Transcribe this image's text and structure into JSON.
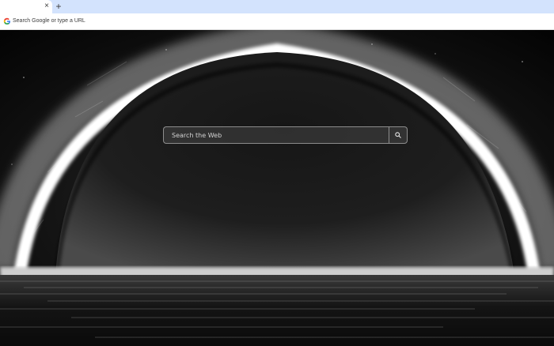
{
  "browser": {
    "tab": {
      "close_glyph": "×"
    },
    "new_tab_glyph": "+",
    "omnibox": {
      "placeholder": "Search Google or type a URL",
      "icon": "google-g-icon"
    }
  },
  "page": {
    "background": "black-hole-over-water",
    "search": {
      "placeholder": "Search the Web",
      "button_icon": "search-icon"
    }
  },
  "colors": {
    "tabstrip": "#d3e3fd",
    "toolbar": "#ffffff",
    "page_background": "#050505"
  }
}
